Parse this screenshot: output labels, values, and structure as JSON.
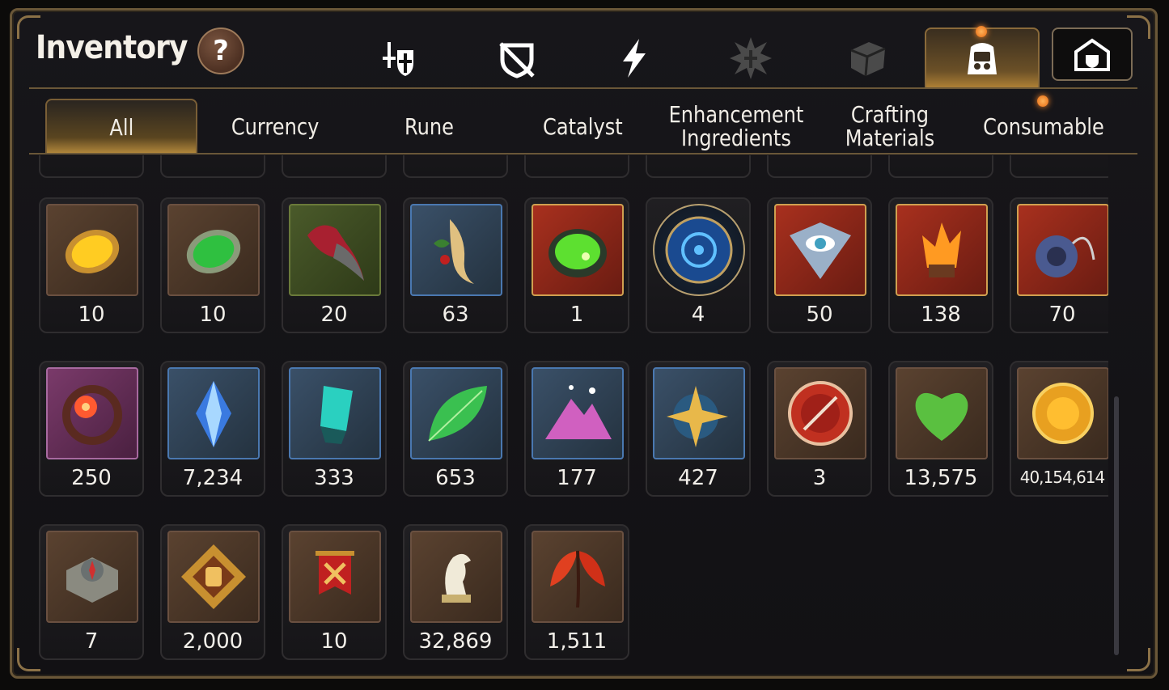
{
  "title": "Inventory",
  "help_label": "?",
  "categories": [
    {
      "name": "equipment-icon"
    },
    {
      "name": "disabled-gear-icon"
    },
    {
      "name": "skill-lightning-icon"
    },
    {
      "name": "burst-icon"
    },
    {
      "name": "cube-icon"
    },
    {
      "name": "bag-icon",
      "active": true
    },
    {
      "name": "house-icon"
    }
  ],
  "tabs": [
    {
      "label": "All"
    },
    {
      "label": "Currency"
    },
    {
      "label": "Rune"
    },
    {
      "label": "Catalyst"
    },
    {
      "label": "Enhancement Ingredients"
    },
    {
      "label": "Crafting Materials"
    },
    {
      "label": "Consumable"
    }
  ],
  "items": [
    {
      "qty": "10",
      "icon": "amber-gem-icon",
      "frame": "brown"
    },
    {
      "qty": "10",
      "icon": "green-gem-icon",
      "frame": "brown"
    },
    {
      "qty": "20",
      "icon": "claw-icon",
      "frame": "green"
    },
    {
      "qty": "63",
      "icon": "ginseng-root-icon",
      "frame": "blue"
    },
    {
      "qty": "1",
      "icon": "green-orb-icon",
      "frame": "red"
    },
    {
      "qty": "4",
      "icon": "rune-disc-icon",
      "frame": "round"
    },
    {
      "qty": "50",
      "icon": "eye-crest-icon",
      "frame": "red"
    },
    {
      "qty": "138",
      "icon": "fire-crystal-icon",
      "frame": "red"
    },
    {
      "qty": "70",
      "icon": "pendant-icon",
      "frame": "red"
    },
    {
      "qty": "250",
      "icon": "flower-ring-icon",
      "frame": "purple"
    },
    {
      "qty": "7,234",
      "icon": "blue-crystal-icon",
      "frame": "blue"
    },
    {
      "qty": "333",
      "icon": "teal-crystal-icon",
      "frame": "blue"
    },
    {
      "qty": "653",
      "icon": "leaf-icon",
      "frame": "blue"
    },
    {
      "qty": "177",
      "icon": "pink-mountain-icon",
      "frame": "blue"
    },
    {
      "qty": "427",
      "icon": "compass-star-icon",
      "frame": "blue"
    },
    {
      "qty": "3",
      "icon": "red-seal-icon",
      "frame": "brown"
    },
    {
      "qty": "13,575",
      "icon": "heart-leaf-icon",
      "frame": "brown"
    },
    {
      "qty": "40,154,614",
      "icon": "gold-coin-icon",
      "frame": "brown"
    },
    {
      "qty": "7",
      "icon": "stone-compass-icon",
      "frame": "brown"
    },
    {
      "qty": "2,000",
      "icon": "fist-emblem-icon",
      "frame": "brown"
    },
    {
      "qty": "10",
      "icon": "war-banner-icon",
      "frame": "brown"
    },
    {
      "qty": "32,869",
      "icon": "horse-statue-icon",
      "frame": "brown"
    },
    {
      "qty": "1,511",
      "icon": "red-leaves-icon",
      "frame": "brown"
    }
  ],
  "colors": {
    "frame_gold": "#6a5738",
    "active_tab": "#b58a3c",
    "notification": "#ff8a2a"
  }
}
